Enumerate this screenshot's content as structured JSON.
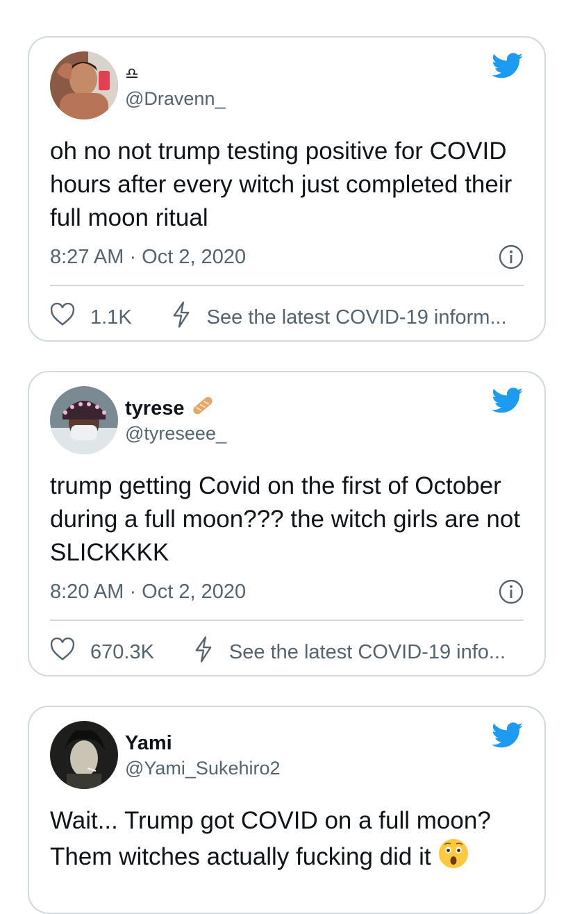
{
  "tweets": [
    {
      "display_name": "♎",
      "handle": "@Dravenn_",
      "text": "oh no not trump testing positive for COVID hours after every witch just completed their full moon ritual",
      "timestamp": "8:27 AM · Oct 2, 2020",
      "likes": "1.1K",
      "covid_link": "See the latest COVID-19 inform..."
    },
    {
      "display_name": "tyrese",
      "handle": "@tyreseee_",
      "text": "trump getting Covid on the first of October during a full moon??? the witch girls are not SLICKKKK",
      "timestamp": "8:20 AM · Oct 2, 2020",
      "likes": "670.3K",
      "covid_link": "See the latest COVID-19 info..."
    },
    {
      "display_name": "Yami",
      "handle": "@Yami_Sukehiro2",
      "text": "Wait... Trump got COVID on a full moon? Them witches actually fucking  did it"
    }
  ],
  "colors": {
    "twitter_blue": "#1d9bf0",
    "secondary_text": "#536471",
    "border": "#cfd9de"
  },
  "icons": [
    "twitter-bird-icon",
    "heart-icon",
    "bolt-icon",
    "info-icon",
    "baguette-emoji",
    "astonished-face-emoji"
  ]
}
